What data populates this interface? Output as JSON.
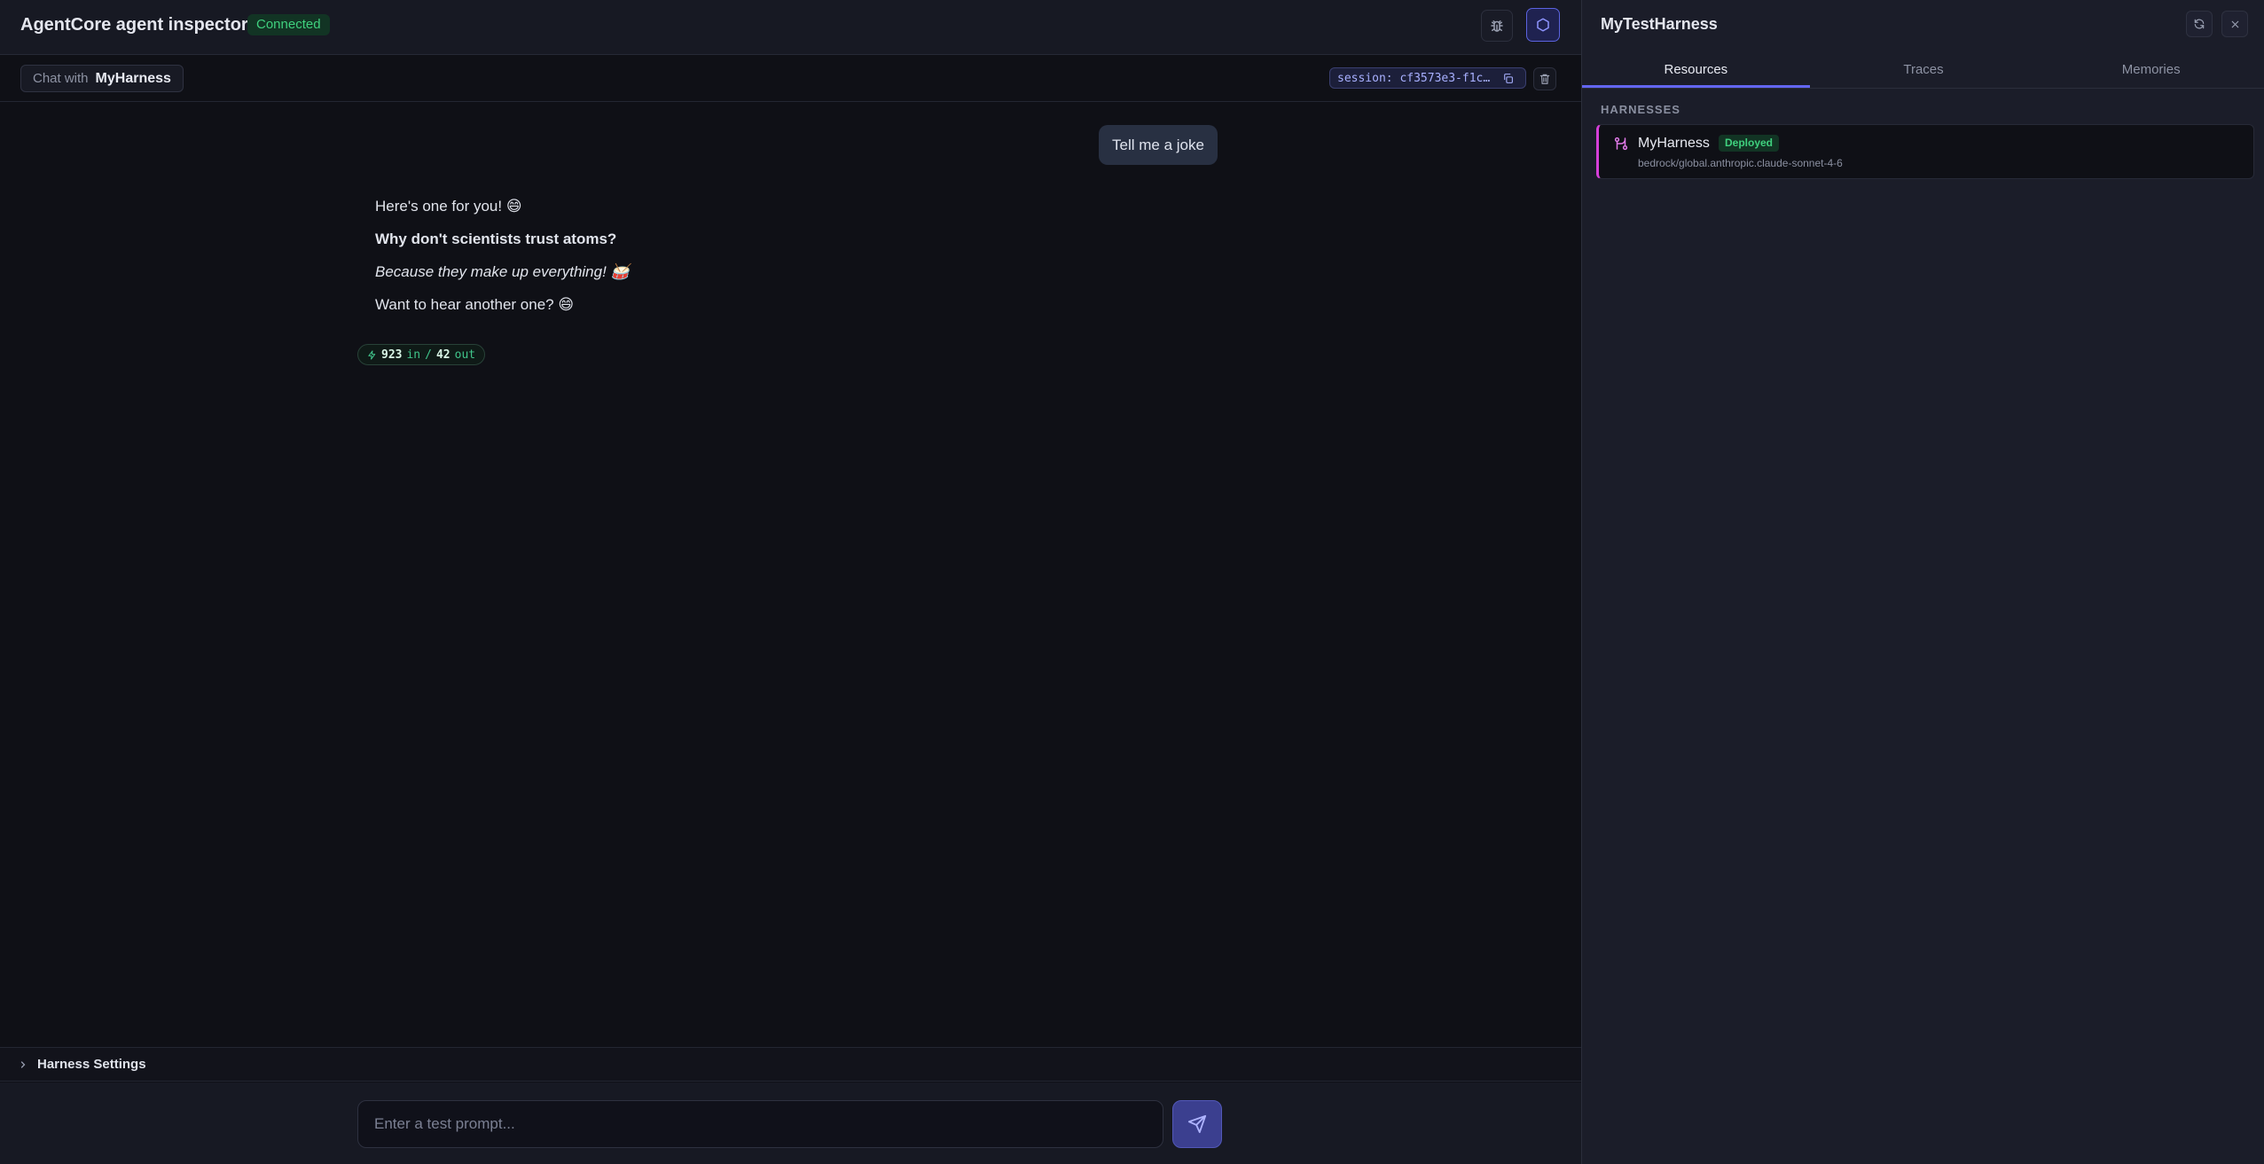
{
  "header": {
    "title": "AgentCore agent inspector",
    "status": "Connected"
  },
  "subbar": {
    "chat_with_label": "Chat with",
    "harness_name": "MyHarness",
    "session": "session: cf3573e3-f1c…"
  },
  "chat": {
    "user_message": "Tell me a joke",
    "assistant_lines": [
      "Here's one for you! 😄",
      "Why don't scientists trust atoms?",
      "Because they make up everything! 🥁",
      "Want to hear another one? 😄"
    ],
    "tokens": {
      "in_value": "923",
      "in_label": "in",
      "separator": "/",
      "out_value": "42",
      "out_label": "out"
    }
  },
  "settings": {
    "label": "Harness Settings"
  },
  "composer": {
    "placeholder": "Enter a test prompt..."
  },
  "panel": {
    "title": "MyTestHarness",
    "tabs": [
      {
        "label": "Resources",
        "active": true
      },
      {
        "label": "Traces",
        "active": false
      },
      {
        "label": "Memories",
        "active": false
      }
    ],
    "section_label": "HARNESSES",
    "harness": {
      "name": "MyHarness",
      "badge": "Deployed",
      "model": "bedrock/global.anthropic.claude-sonnet-4-6"
    }
  },
  "colors": {
    "accent": "#6366f1",
    "status_green": "#3fd07e",
    "harness_marker": "#d63fd9"
  },
  "icons": [
    "bug-icon",
    "hexagon-icon",
    "copy-icon",
    "trash-icon",
    "zap-icon",
    "chevron-right-icon",
    "send-icon",
    "refresh-icon",
    "close-icon",
    "harness-icon"
  ]
}
